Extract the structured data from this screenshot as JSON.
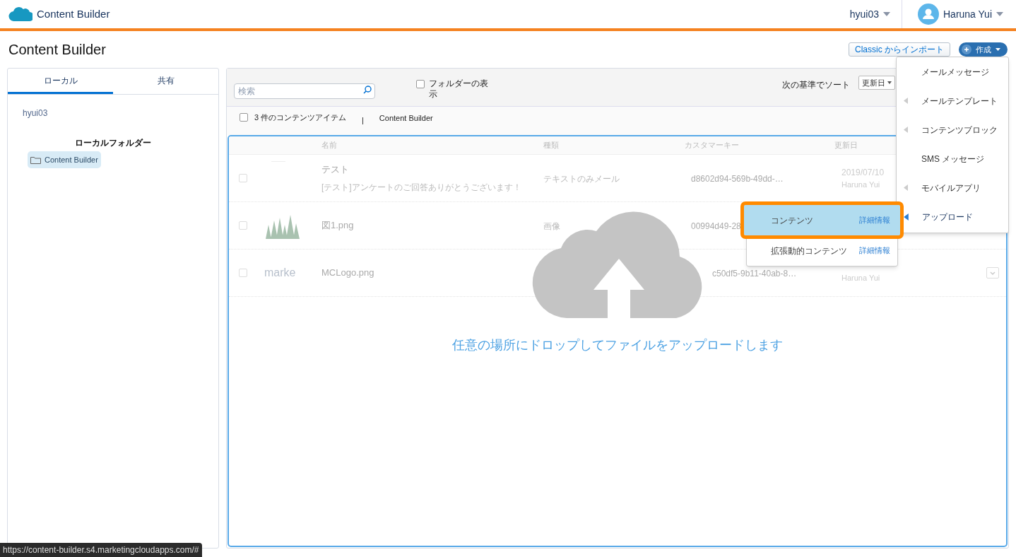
{
  "header": {
    "app_title": "Content Builder",
    "org": "hyui03",
    "user": "Haruna Yui"
  },
  "page_title": "Content Builder",
  "buttons": {
    "import": "Classic からインポート",
    "create": "作成"
  },
  "sidebar": {
    "tabs": [
      {
        "label": "ローカル",
        "selected": true
      },
      {
        "label": "共有",
        "selected": false
      }
    ],
    "owner": "hyui03",
    "section_title": "ローカルフォルダー",
    "folders": [
      {
        "label": "Content Builder",
        "selected": true
      }
    ]
  },
  "toolbar": {
    "search": {
      "placeholder": "検索"
    },
    "show_folders": {
      "label": "フォルダーの表示",
      "checked": false
    },
    "sort_label": "次の基準でソート",
    "sort_value": "更新日"
  },
  "info": {
    "checked": false,
    "count": "3 件のコンテンツアイテム",
    "separator": "|",
    "breadcrumb": "Content Builder"
  },
  "table": {
    "columns": [
      "名前",
      "種類",
      "カスタマーキー",
      "更新日"
    ],
    "rows": [
      {
        "kind": "blank",
        "checked": false,
        "name": "テスト",
        "subtitle": "[テスト]アンケートのご回答ありがとうございます！",
        "type": "テキストのみメール",
        "key": "d8602d94-569b-49dd-…",
        "date": "2019/07/10",
        "modified_by": "Haruna Yui"
      },
      {
        "kind": "picture",
        "checked": false,
        "name": "図1.png",
        "type": "画像",
        "key": "00994d49-28"
      },
      {
        "kind": "text",
        "checked": false,
        "thumb_text": "marke",
        "name": "MCLogo.png",
        "key": "c50df5-9b11-40ab-8…",
        "modified_by": "Haruna Yui",
        "has_menu": true
      }
    ]
  },
  "drop_zone": {
    "message": "任意の場所にドロップしてファイルをアップロードします"
  },
  "create_menu": [
    {
      "label": "メールメッセージ",
      "has_submenu": false,
      "active": false
    },
    {
      "label": "メールテンプレート",
      "has_submenu": true,
      "active": false
    },
    {
      "label": "コンテンツブロック",
      "has_submenu": true,
      "active": false
    },
    {
      "label": "SMS メッセージ",
      "has_submenu": false,
      "active": false
    },
    {
      "label": "モバイルアプリ",
      "has_submenu": true,
      "active": false
    },
    {
      "label": "アップロード",
      "has_submenu": true,
      "active": true
    }
  ],
  "submenu": [
    {
      "label": "コンテンツ",
      "link": "詳細情報",
      "selected": true
    },
    {
      "label": "拡張動的コンテンツ",
      "link": "詳細情報",
      "selected": false
    }
  ],
  "status_bar": {
    "url": "https://content-builder.s4.marketingcloudapps.com/#"
  }
}
